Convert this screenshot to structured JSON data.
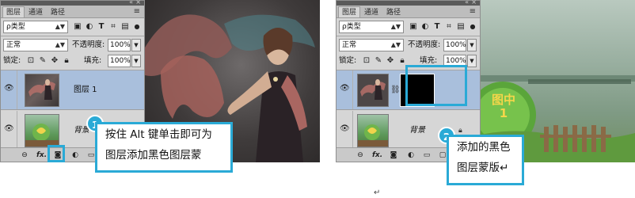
{
  "panels": [
    {
      "tabs": [
        "图层",
        "通道",
        "路径"
      ],
      "filter_kind": "ρ类型",
      "blend_mode": "正常",
      "opacity_label": "不透明度:",
      "opacity_value": "100%",
      "lock_label": "锁定:",
      "fill_label": "填充:",
      "fill_value": "100%",
      "layers": [
        {
          "name": "图层 1",
          "selected": true
        },
        {
          "name": "背景",
          "selected": false
        }
      ],
      "bottom_fx": "fx."
    },
    {
      "tabs": [
        "图层",
        "通道",
        "路径"
      ],
      "filter_kind": "ρ类型",
      "blend_mode": "正常",
      "opacity_label": "不透明度:",
      "opacity_value": "100%",
      "lock_label": "锁定:",
      "fill_label": "填充:",
      "fill_value": "100%",
      "layers": [
        {
          "name": "",
          "selected": true
        },
        {
          "name": "背景",
          "selected": false
        }
      ],
      "bottom_fx": "fx."
    }
  ],
  "callouts": [
    {
      "badge": "1",
      "line1": "按住 Alt 键单击即可为",
      "line2": "图层添加黑色图层蒙"
    },
    {
      "badge": "2",
      "line1": "添加的黑色",
      "line2": "图层蒙版↵"
    }
  ],
  "photo2_sign": "图中\n1",
  "bottom_mark": "↵",
  "colors": {
    "accent": "#2aaad6",
    "selected_layer": "#a9bfdc",
    "panel": "#d6d6d6"
  }
}
